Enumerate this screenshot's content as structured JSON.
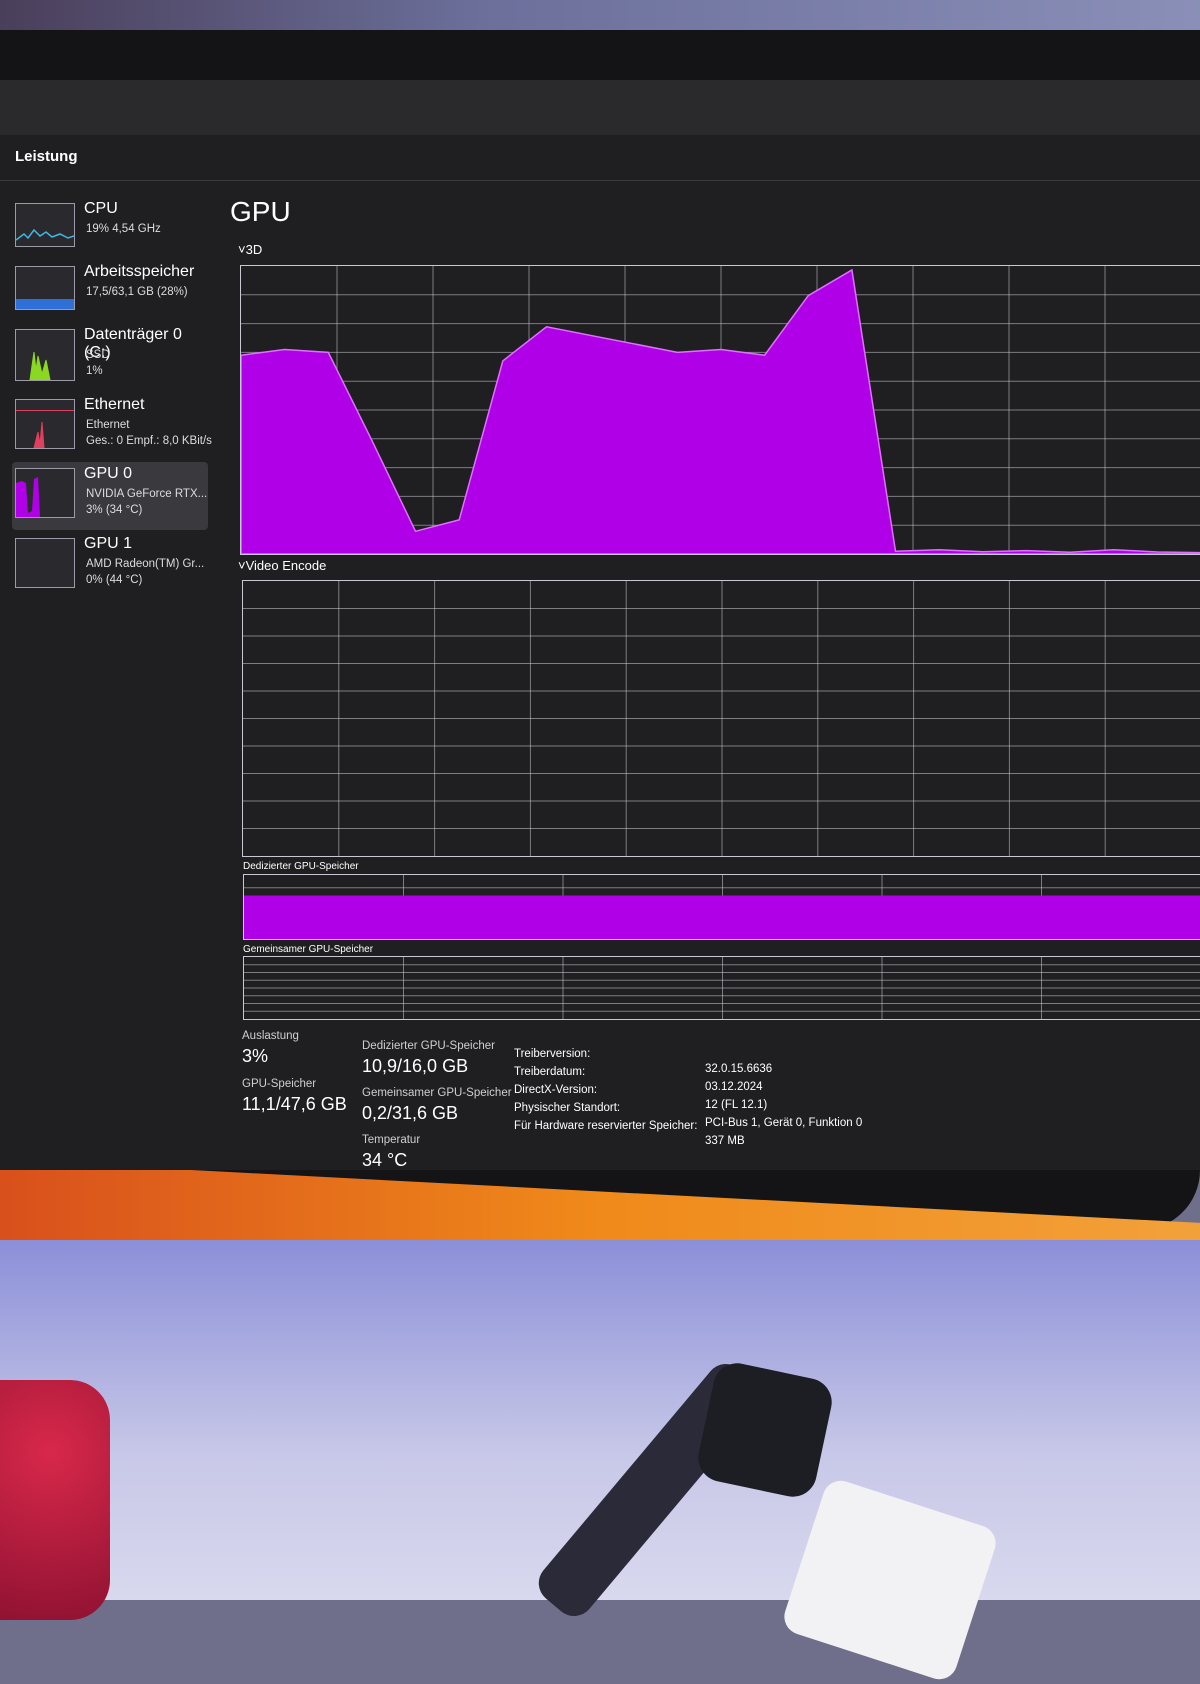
{
  "title": "Leistung",
  "sidebar": {
    "items": [
      {
        "name": "CPU",
        "sub1": "19% 4,54 GHz",
        "sub2": "",
        "sub3": ""
      },
      {
        "name": "Arbeitsspeicher",
        "sub1": "17,5/63,1 GB (28%)",
        "sub2": "",
        "sub3": ""
      },
      {
        "name": "Datenträger 0 (C:)",
        "sub1": "SSD",
        "sub2": "1%",
        "sub3": ""
      },
      {
        "name": "Ethernet",
        "sub1": "Ethernet",
        "sub2": "Ges.: 0 Empf.: 8,0 KBit/s",
        "sub3": ""
      },
      {
        "name": "GPU 0",
        "sub1": "NVIDIA GeForce RTX...",
        "sub2": "3% (34 °C)",
        "sub3": ""
      },
      {
        "name": "GPU 1",
        "sub1": "AMD Radeon(TM) Gr...",
        "sub2": "0% (44 °C)",
        "sub3": ""
      }
    ],
    "selected_index": 4
  },
  "main": {
    "heading": "GPU",
    "graph_3d_label": "3D",
    "graph_encode_label": "Video Encode",
    "dedicated_mem_label": "Dedizierter GPU-Speicher",
    "shared_mem_label": "Gemeinsamer GPU-Speicher"
  },
  "stats": {
    "utilization_label": "Auslastung",
    "utilization_value": "3%",
    "gpu_mem_label": "GPU-Speicher",
    "gpu_mem_value": "11,1/47,6 GB",
    "dedicated_label": "Dedizierter GPU-Speicher",
    "dedicated_value": "10,9/16,0 GB",
    "shared_label": "Gemeinsamer GPU-Speicher",
    "shared_value": "0,2/31,6 GB",
    "temp_label": "Temperatur",
    "temp_value": "34 °C"
  },
  "info": {
    "keys": [
      "Treiberversion:",
      "Treiberdatum:",
      "DirectX-Version:",
      "Physischer Standort:",
      "Für Hardware reservierter Speicher:"
    ],
    "values": [
      "32.0.15.6636",
      "03.12.2024",
      "12 (FL 12.1)",
      "PCI-Bus 1, Gerät 0, Funktion 0",
      "337 MB"
    ]
  },
  "graph_3d_series": [
    70,
    72,
    71,
    40,
    8,
    12,
    68,
    80,
    77,
    74,
    71,
    72,
    70,
    91,
    100,
    1,
    1.5,
    0.8,
    1.2,
    0.6,
    1.5,
    0.7,
    0.5
  ],
  "dedicated_fill_percent": 68,
  "colors": {
    "accent": "#b000e8",
    "grid": "#c8c8d4"
  }
}
